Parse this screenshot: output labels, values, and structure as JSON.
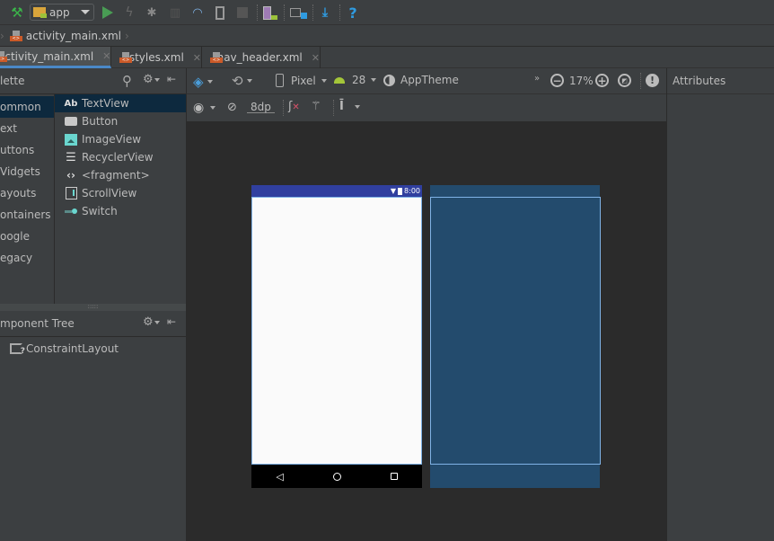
{
  "toolbar": {
    "run_config": "app",
    "icons": [
      "build-icon",
      "run-config-icon",
      "run-icon",
      "apply-changes-icon",
      "debug-icon",
      "profile-icon",
      "profiler-icon",
      "attach-debugger-icon",
      "stop-icon",
      "avd-manager-icon",
      "project-structure-icon",
      "sdk-manager-icon",
      "help-icon"
    ]
  },
  "breadcrumb": {
    "file": "activity_main.xml"
  },
  "tabs": [
    {
      "label": "activity_main.xml",
      "active": true
    },
    {
      "label": "styles.xml",
      "active": false
    },
    {
      "label": "nav_header.xml",
      "active": false
    }
  ],
  "palette": {
    "title": "Palette",
    "title_visible": "lette",
    "categories": [
      "Common",
      "Text",
      "Buttons",
      "Widgets",
      "Layouts",
      "Containers",
      "Google",
      "Legacy"
    ],
    "categories_visible": [
      "ommon",
      "ext",
      "uttons",
      "Vidgets",
      "ayouts",
      "ontainers",
      "oogle",
      "egacy"
    ],
    "selected_category": "Common",
    "items": [
      {
        "label": "TextView",
        "icon": "textview-icon",
        "glyph": "Ab"
      },
      {
        "label": "Button",
        "icon": "button-icon",
        "glyph": ""
      },
      {
        "label": "ImageView",
        "icon": "imageview-icon",
        "glyph": ""
      },
      {
        "label": "RecyclerView",
        "icon": "recyclerview-icon",
        "glyph": "☰"
      },
      {
        "label": "<fragment>",
        "icon": "fragment-icon",
        "glyph": "‹›"
      },
      {
        "label": "ScrollView",
        "icon": "scrollview-icon",
        "glyph": ""
      },
      {
        "label": "Switch",
        "icon": "switch-icon",
        "glyph": ""
      }
    ],
    "selected_item": "TextView"
  },
  "component_tree": {
    "title": "Component Tree",
    "title_visible": "mponent Tree",
    "root": "ConstraintLayout"
  },
  "design_toolbar": {
    "device": "Pixel",
    "api_level": "28",
    "theme": "AppTheme",
    "zoom": "17%",
    "margin": "8dp",
    "overflow": "»"
  },
  "attributes": {
    "title": "Attributes"
  },
  "preview": {
    "status_time": "8:00",
    "colors": {
      "status_bar": "#303f9f",
      "blueprint": "#234b6d",
      "selection": "#7fb2e6"
    }
  }
}
